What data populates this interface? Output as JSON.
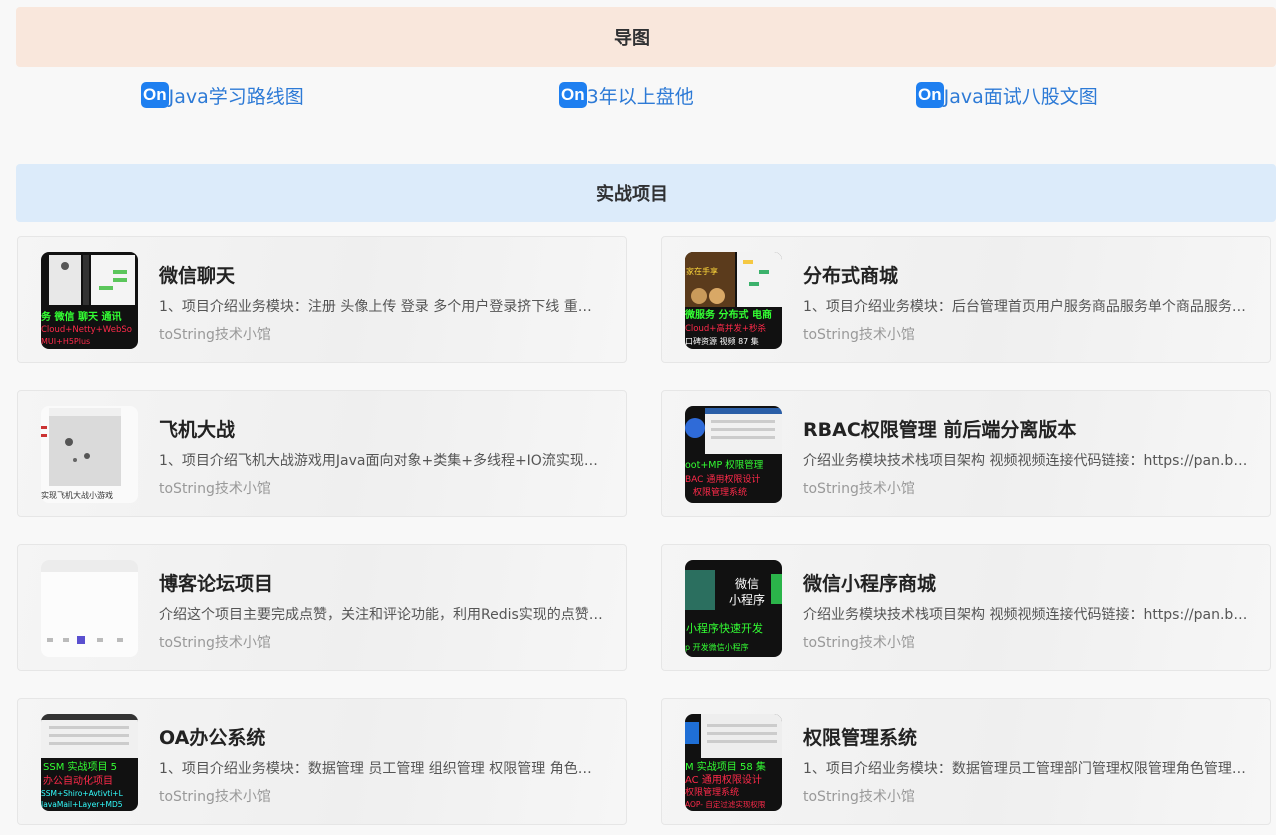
{
  "sections": {
    "mindmap_title": "导图",
    "projects_title": "实战项目"
  },
  "mindmaps": [
    {
      "badge": "On",
      "label": "Java学习路线图"
    },
    {
      "badge": "On",
      "label": "3年以上盘他"
    },
    {
      "badge": "On",
      "label": "Java面试八股文图"
    }
  ],
  "projects": [
    {
      "title": "微信聊天",
      "desc": "1、项目介绍业务模块：注册 头像上传 登录 多个用户登录挤下线 重复登录 发送文字消息 接收消息 消息推送...",
      "author": "toString技术小馆",
      "thumb_text": [
        "务 微信 聊天 通讯",
        "Cloud+Netty+WebSo",
        "MUI+H5Plus"
      ]
    },
    {
      "title": "分布式商城",
      "desc": "1、项目介绍业务模块：后台管理首页用户服务商品服务单个商品服务分类服务品牌服务搜索服务订单服务...",
      "author": "toString技术小馆",
      "thumb_text": [
        "家在手享",
        "微服务 分布式 电商",
        "Cloud+高并发+秒杀",
        "口碑资源 视频 87 集"
      ]
    },
    {
      "title": "飞机大战",
      "desc": "1、项目介绍飞机大战游戏用Java面向对象+类集+多线程+IO流实现的小游戏...",
      "author": "toString技术小馆",
      "thumb_text": [
        "实现飞机大战小游戏"
      ]
    },
    {
      "title": "RBAC权限管理 前后端分离版本",
      "desc": "介绍业务模块技术栈项目架构 视频视频连接代码链接：https://pan.baidu.com/s/...",
      "author": "toString技术小馆",
      "thumb_text": [
        "oot+MP 权限管理",
        "BAC 通用权限设计",
        "权限管理系统"
      ]
    },
    {
      "title": "博客论坛项目",
      "desc": "介绍这个项目主要完成点赞，关注和评论功能，利用Redis实现的点赞关注功能...",
      "author": "toString技术小馆",
      "thumb_text": []
    },
    {
      "title": "微信小程序商城",
      "desc": "介绍业务模块技术栈项目架构 视频视频连接代码链接：https://pan.baidu.com/s/...",
      "author": "toString技术小馆",
      "thumb_text": [
        "微信",
        "小程序",
        "小程序快速开发",
        "p 开发微信小程序"
      ]
    },
    {
      "title": "OA办公系统",
      "desc": "1、项目介绍业务模块：数据管理 员工管理 组织管理 权限管理 角色管理 审批流程 请假管理...",
      "author": "toString技术小馆",
      "thumb_text": [
        "SSM 实战项目 5",
        "办公自动化项目",
        "SSM+Shiro+Avtivti+L",
        "JavaMail+Layer+MD5"
      ]
    },
    {
      "title": "权限管理系统",
      "desc": "1、项目介绍业务模块：数据管理员工管理部门管理权限管理角色管理菜单管理日志管理...",
      "author": "toString技术小馆",
      "thumb_text": [
        "M 实战项目 58 集",
        "AC 通用权限设计",
        "权限管理系统",
        "AOP- 自定过滤实现权限"
      ]
    }
  ],
  "colors": {
    "mindmap_header_bg": "#f9e7dc",
    "projects_header_bg": "#dcebfa",
    "link": "#2d7ad6",
    "badge": "#1e7ff0"
  }
}
